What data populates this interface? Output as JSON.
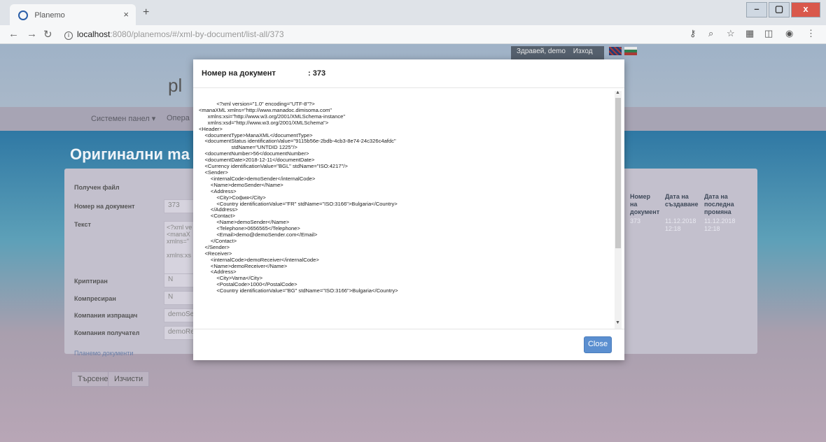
{
  "browser": {
    "tab_title": "Planemo",
    "tab_close": "×",
    "new_tab": "+",
    "url_host": "localhost",
    "url_path": ":8080/planemos/#/xml-by-document/list-all/373",
    "win_min": "–",
    "win_max": "▢",
    "win_close": "x"
  },
  "header": {
    "user_greeting": "Здравей, demo",
    "logout": "Изход",
    "logo_text": "pl"
  },
  "menu": {
    "system_panel": "Системен панел ▾",
    "operations": "Опера"
  },
  "page": {
    "title": "Оригинални ma",
    "form": {
      "received_file": "Получен файл",
      "doc_number_label": "Номер на документ",
      "doc_number_value": "373",
      "text_label": "Текст",
      "text_value": "<?xml ve\n<manaX\nxmlns=\"\n\nxmlns:xs",
      "encrypted_label": "Криптиран",
      "encrypted_value": "N",
      "compressed_label": "Компресиран",
      "compressed_value": "N",
      "sender_company_label": "Компания изпращач",
      "sender_company_value": "demoSe",
      "receiver_company_label": "Компания получател",
      "receiver_company_value": "demoRe",
      "link": "Планемо документи"
    },
    "buttons": {
      "search": "Търсене",
      "clear": "Изчисти"
    },
    "table": {
      "headers": [
        "Номер на документ",
        "Дата на създаване",
        "Дата на последна промяна"
      ],
      "row": [
        "373",
        "11.12.2018 12:18",
        "11.12.2018 12:18"
      ]
    }
  },
  "modal": {
    "title": "Номер на документ",
    "number": ": 373",
    "close_label": "Close",
    "xml_lines": [
      "            <?xml version=\"1.0\" encoding=\"UTF-8\"?>",
      "<manaXML xmlns=\"http://www.manadoc.dimisoma.com\"",
      "      xmlns:xsi=\"http://www.w3.org/2001/XMLSchema-instance\"",
      "      xmlns:xsd=\"http://www.w3.org/2001/XMLSchema\">",
      "<Header>",
      "    <documentType>ManaXML</documentType>",
      "    <documentStatus identificationValue=\"9115b56e-2bdb-4cb3-8e74-24c326c4afdc\"",
      "                      stdName=\"UNTDID 1225\"/>",
      "    <documentNumber>56</documentNumber>",
      "    <documentDate>2018-12-11</documentDate>",
      "    <Currency identificationValue=\"BGL\" stdName=\"ISO:4217\"/>",
      "    <Sender>",
      "        <internalCode>demoSender</internalCode>",
      "        <Name>demoSender</Name>",
      "        <Address>",
      "            <City>София</City>",
      "            <Country identificationValue=\"FR\" stdName=\"ISO:3166\">Bulgaria</Country>",
      "        </Address>",
      "        <Contact>",
      "            <Name>demoSender</Name>",
      "            <Telephone>0656565</Telephone>",
      "            <Email>demo@demoSender.com</Email>",
      "        </Contact>",
      "    </Sender>",
      "    <Receiver>",
      "        <internalCode>demoReceiver</internalCode>",
      "        <Name>demoReceiver</Name>",
      "        <Address>",
      "            <City>Varna</City>",
      "            <PostalCode>1000</PostalCode>",
      "            <Country identificationValue=\"BG\" stdName=\"ISO:3166\">Bulgaria</Country>"
    ]
  }
}
